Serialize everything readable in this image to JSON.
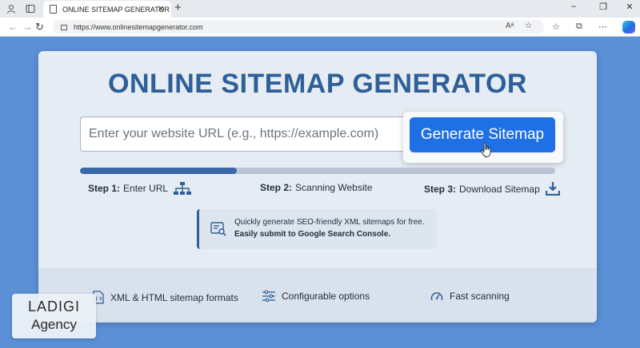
{
  "browser": {
    "tab_title": "ONLINE SITEMAP GENERATOR",
    "url": "https://www.onlinesitemapgenerator.com",
    "icons": [
      "profile-icon",
      "tabs-icon",
      "doc-icon",
      "close-icon",
      "new-tab-icon",
      "minimize-icon",
      "maximize-icon",
      "window-close-icon",
      "back-icon",
      "forward-icon",
      "refresh-icon",
      "lock-icon",
      "read-aloud-icon",
      "favorite-icon",
      "favorites-icon",
      "collections-icon",
      "copilot-icon"
    ]
  },
  "page": {
    "title": "ONLINE SITEMAP GENERATOR",
    "url_input": {
      "placeholder": "Enter your website URL (e.g., https://example.com)",
      "value": ""
    },
    "generate_button": "Generate Sitemap",
    "progress_percent": 33,
    "steps": [
      {
        "num": "Step 1:",
        "label": "Enter URL",
        "icon": "sitemap-icon"
      },
      {
        "num": "Step 2:",
        "label": "Scanning Website",
        "icon": ""
      },
      {
        "num": "Step 3:",
        "label": "Download Sitemap",
        "icon": "download-icon"
      }
    ],
    "info": {
      "line1": "Quickly generate SEO-friendly XML sitemaps for free.",
      "line2": "Easily submit to Google Search Console.",
      "icon": "search-console-icon"
    },
    "features": [
      {
        "label": "XML & HTML sitemap formats",
        "icon": "file-code-icon"
      },
      {
        "label": "Configurable options",
        "icon": "sliders-icon"
      },
      {
        "label": "Fast scanning",
        "icon": "speedometer-icon"
      }
    ]
  },
  "watermark": {
    "line1": "LADIGI",
    "line2": "Agency"
  },
  "colors": {
    "background": "#5b8fd6",
    "title": "#2f5f98",
    "button": "#1f6fe5",
    "progress_fill": "#3a67a5",
    "progress_track": "#b9c4d2"
  }
}
